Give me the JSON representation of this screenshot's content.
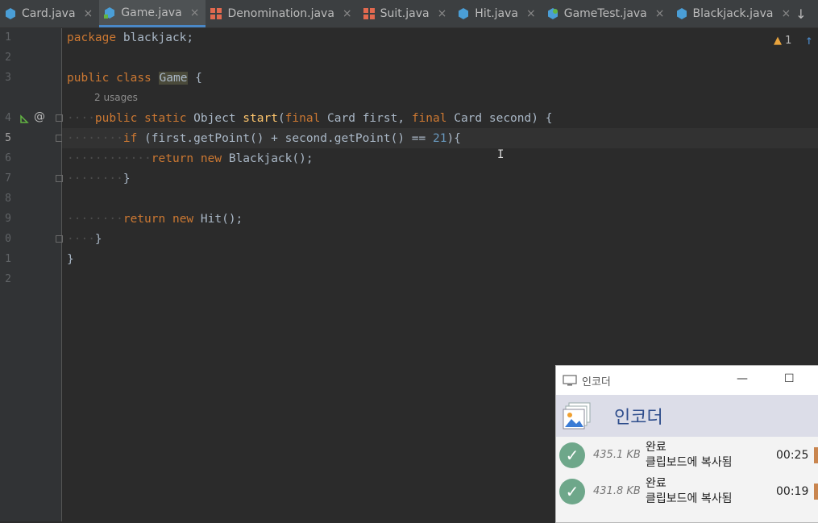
{
  "tabs": [
    {
      "label": "Card.java",
      "icon": "class-icon",
      "active": false
    },
    {
      "label": "Game.java",
      "icon": "class-icon",
      "active": true
    },
    {
      "label": "Denomination.java",
      "icon": "enum-icon",
      "active": false
    },
    {
      "label": "Suit.java",
      "icon": "enum-icon",
      "active": false
    },
    {
      "label": "Hit.java",
      "icon": "class-icon",
      "active": false
    },
    {
      "label": "GameTest.java",
      "icon": "test-class-icon",
      "active": false
    },
    {
      "label": "Blackjack.java",
      "icon": "class-icon",
      "active": false
    }
  ],
  "tab_close_glyph": "×",
  "tab_overflow_glyph": "↓",
  "editor": {
    "line_numbers": [
      "1",
      "2",
      "3",
      "4",
      "5",
      "6",
      "7",
      "8",
      "9",
      "0",
      "1",
      "2"
    ],
    "current_line": "5",
    "inlay_hint": "2 usages",
    "warning_count": "1",
    "lines": {
      "l1_kw": "package",
      "l1_rest": " blackjack;",
      "l3_kw1": "public",
      "l3_kw2": "class",
      "l3_name": "Game",
      "l3_rest": " {",
      "l4_kw1": "public",
      "l4_kw2": "static",
      "l4_type": " Object ",
      "l4_fn": "start",
      "l4_p1": "(",
      "l4_kw3": "final",
      "l4_p2": " Card first, ",
      "l4_kw4": "final",
      "l4_p3": " Card second) {",
      "l5_kw": "if",
      "l5_a": " (first.getPoint() + second.getPoint() == ",
      "l5_num": "21",
      "l5_b": "){",
      "l6_kw1": "return",
      "l6_kw2": "new",
      "l6_rest": " Blackjack();",
      "l7_brace": "}",
      "l9_kw1": "return",
      "l9_kw2": "new",
      "l9_rest": " Hit();",
      "l10_brace": "}",
      "l11_brace": "}"
    }
  },
  "popup": {
    "window_title": "인코더",
    "minimize_glyph": "—",
    "maximize_glyph": "☐",
    "header_title": "인코더",
    "items": [
      {
        "size": "435.1 KB",
        "status": "완료",
        "detail": "클립보드에 복사됨",
        "time": "00:25"
      },
      {
        "size": "431.8 KB",
        "status": "완료",
        "detail": "클립보드에 복사됨",
        "time": "00:19"
      }
    ]
  },
  "colors": {
    "keyword": "#cc7832",
    "function": "#ffc66d",
    "number": "#6897bb",
    "text": "#a9b7c6",
    "class_icon": "#4a9ed6",
    "enum_icon": "#e2694f",
    "check": "#6ea78a"
  }
}
